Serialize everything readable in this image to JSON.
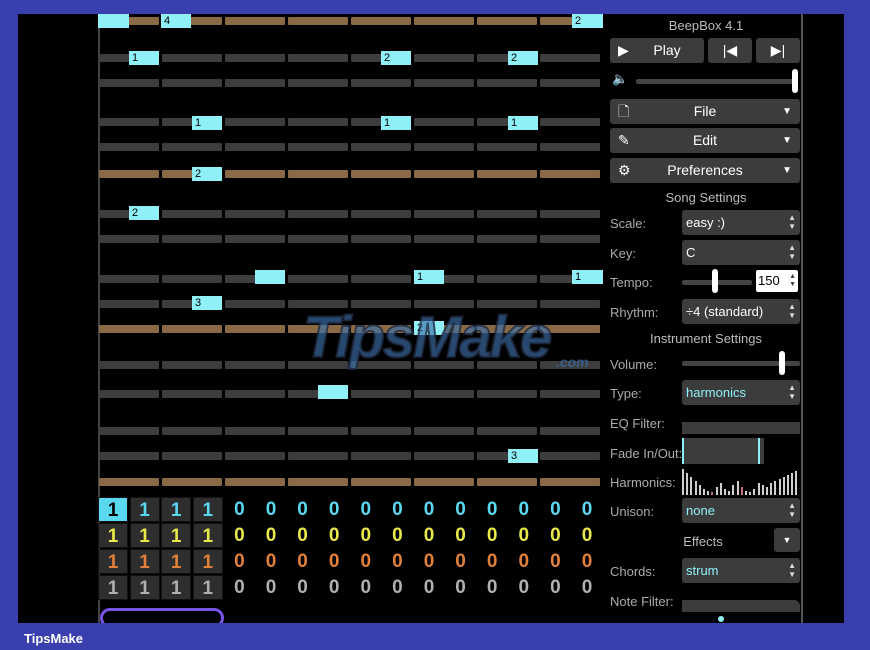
{
  "app": {
    "title": "BeepBox 4.1"
  },
  "transport": {
    "play_label": "Play"
  },
  "menus": [
    {
      "label": "File"
    },
    {
      "label": "Edit"
    },
    {
      "label": "Preferences"
    }
  ],
  "song_settings": {
    "heading": "Song Settings",
    "scale_label": "Scale:",
    "scale_value": "easy :)",
    "key_label": "Key:",
    "key_value": "C",
    "tempo_label": "Tempo:",
    "tempo_value": "150",
    "rhythm_label": "Rhythm:",
    "rhythm_value": "÷4 (standard)"
  },
  "instrument_settings": {
    "heading": "Instrument Settings",
    "volume_label": "Volume:",
    "type_label": "Type:",
    "type_value": "harmonics",
    "eq_label": "EQ Filter:",
    "fade_label": "Fade In/Out:",
    "harmonics_label": "Harmonics:",
    "unison_label": "Unison:",
    "unison_value": "none",
    "effects_label": "Effects",
    "chords_label": "Chords:",
    "chords_value": "strum",
    "note_filter_label": "Note Filter:"
  },
  "pattern_notes": [
    {
      "label": ""
    },
    {
      "label": "4"
    },
    {
      "label": "2"
    },
    {
      "label": "1"
    },
    {
      "label": "2"
    },
    {
      "label": "2"
    },
    {
      "label": "1"
    },
    {
      "label": "1"
    },
    {
      "label": "1"
    },
    {
      "label": "2"
    },
    {
      "label": "2"
    },
    {
      "label": ""
    },
    {
      "label": "1"
    },
    {
      "label": "1"
    },
    {
      "label": "3"
    },
    {
      "label": "2"
    },
    {
      "label": ""
    },
    {
      "label": "3"
    }
  ],
  "track_rows": [
    {
      "color": "#5ad8f0",
      "values": [
        "1",
        "1",
        "1",
        "1",
        "0",
        "0",
        "0",
        "0",
        "0",
        "0",
        "0",
        "0",
        "0",
        "0",
        "0",
        "0"
      ]
    },
    {
      "color": "#e8e84a",
      "values": [
        "1",
        "1",
        "1",
        "1",
        "0",
        "0",
        "0",
        "0",
        "0",
        "0",
        "0",
        "0",
        "0",
        "0",
        "0",
        "0"
      ]
    },
    {
      "color": "#e0803a",
      "values": [
        "1",
        "1",
        "1",
        "1",
        "0",
        "0",
        "0",
        "0",
        "0",
        "0",
        "0",
        "0",
        "0",
        "0",
        "0",
        "0"
      ]
    },
    {
      "color": "#b0b0b0",
      "values": [
        "1",
        "1",
        "1",
        "1",
        "0",
        "0",
        "0",
        "0",
        "0",
        "0",
        "0",
        "0",
        "0",
        "0",
        "0",
        "0"
      ]
    }
  ],
  "watermark": {
    "text": "TipsMake",
    "suffix": ".com"
  },
  "footer": {
    "brand": "TipsMake"
  }
}
